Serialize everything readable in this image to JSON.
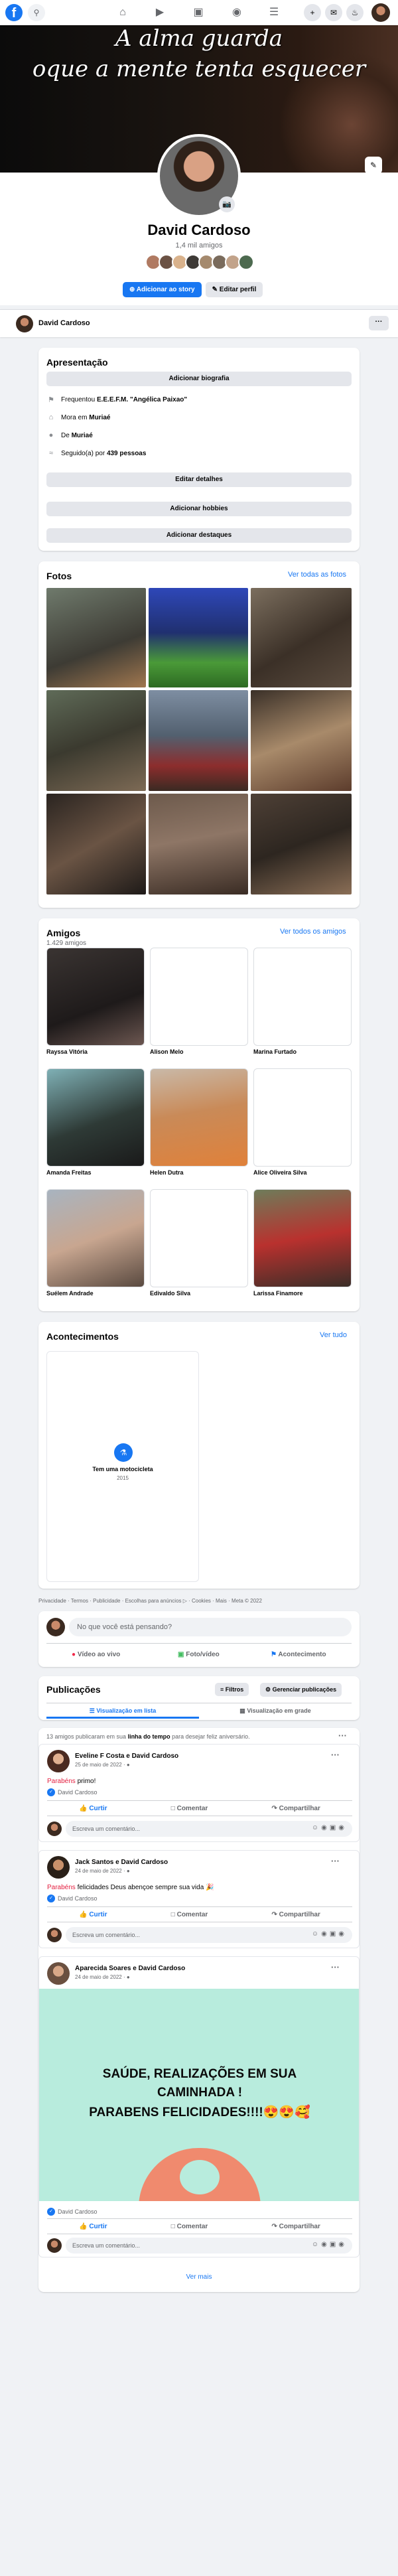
{
  "topbar": {
    "logo": "f",
    "icons": [
      "search-icon",
      "home-icon",
      "watch-icon",
      "marketplace-icon",
      "groups-icon",
      "menu-icon",
      "plus-icon",
      "messenger-icon",
      "bell-icon"
    ]
  },
  "cover": {
    "line1": "A alma guarda",
    "line2": "oque a mente tenta esquecer"
  },
  "profile": {
    "name": "David Cardoso",
    "friends_count": "1,4 mil amigos",
    "add_story": "Adicionar ao story",
    "edit_profile": "Editar perfil"
  },
  "tabs_bar": {
    "name": "David Cardoso",
    "more": "···"
  },
  "intro": {
    "title": "Apresentação",
    "add_bio": "Adicionar biografia",
    "rows": [
      {
        "icon": "school-icon",
        "prefix": "Frequentou ",
        "value": "E.E.E.F.M. \"Angélica Paixao\""
      },
      {
        "icon": "home-icon",
        "prefix": "Mora em ",
        "value": "Muriaé"
      },
      {
        "icon": "location-icon",
        "prefix": "De ",
        "value": "Muriaé"
      },
      {
        "icon": "followers-icon",
        "prefix": "Seguido(a) por ",
        "value": "439 pessoas"
      }
    ],
    "edit_details": "Editar detalhes",
    "add_hobbies": "Adicionar hobbies",
    "add_featured": "Adicionar destaques"
  },
  "photos": {
    "title": "Fotos",
    "see_all": "Ver todas as fotos"
  },
  "friends": {
    "title": "Amigos",
    "count": "1.429 amigos",
    "see_all": "Ver todos os amigos",
    "list": [
      "Rayssa Vitória",
      "Alison Melo",
      "Marina Furtado",
      "Amanda Freitas",
      "Helen Dutra",
      "Alice Oliveira Silva",
      "Suélem Andrade",
      "Edivaldo Silva",
      "Larissa Finamore"
    ]
  },
  "events": {
    "title": "Acontecimentos",
    "see_all": "Ver tudo",
    "item_title": "Tem uma motocicleta",
    "item_year": "2015"
  },
  "footer": "Privacidade · Termos · Publicidade · Escolhas para anúncios ▷ · Cookies · Mais · Meta © 2022",
  "composer": {
    "placeholder": "No que você está pensando?",
    "live": "Vídeo ao vivo",
    "photo": "Foto/vídeo",
    "event": "Acontecimento"
  },
  "posts_header": {
    "title": "Publicações",
    "filters": "Filtros",
    "manage": "Gerenciar publicações",
    "list_view": "Visualização em lista",
    "grid_view": "Visualização em grade",
    "birthday_prefix": "13 amigos publicaram em sua ",
    "birthday_bold": "linha do tempo",
    "birthday_suffix": " para desejar feliz aniversário."
  },
  "posts": [
    {
      "author": "Eveline F Costa e David Cardoso",
      "date": "25 de maio de 2022 · ",
      "red": "Parabéns",
      "text": " primo!",
      "likes": "David Cardoso"
    },
    {
      "author": "Jack Santos e David Cardoso",
      "date": "24 de maio de 2022 · ",
      "red": "Parabéns",
      "text": " felicidades Deus abençoe sempre sua vida 🎉",
      "likes": "David Cardoso"
    },
    {
      "author": "Aparecida Soares e David Cardoso",
      "date": "24 de maio de 2022 · ",
      "image_text_1": "SAÚDE, REALIZAÇÕES EM SUA",
      "image_text_2": "CAMINHADA !",
      "image_text_3": "PARABENS FELICIDADES!!!!😍😍🥰",
      "likes": "David Cardoso"
    }
  ],
  "post_actions": {
    "like": "Curtir",
    "comment": "Comentar",
    "share": "Compartilhar",
    "comment_placeholder": "Escreva um comentário..."
  },
  "see_more": "Ver mais"
}
